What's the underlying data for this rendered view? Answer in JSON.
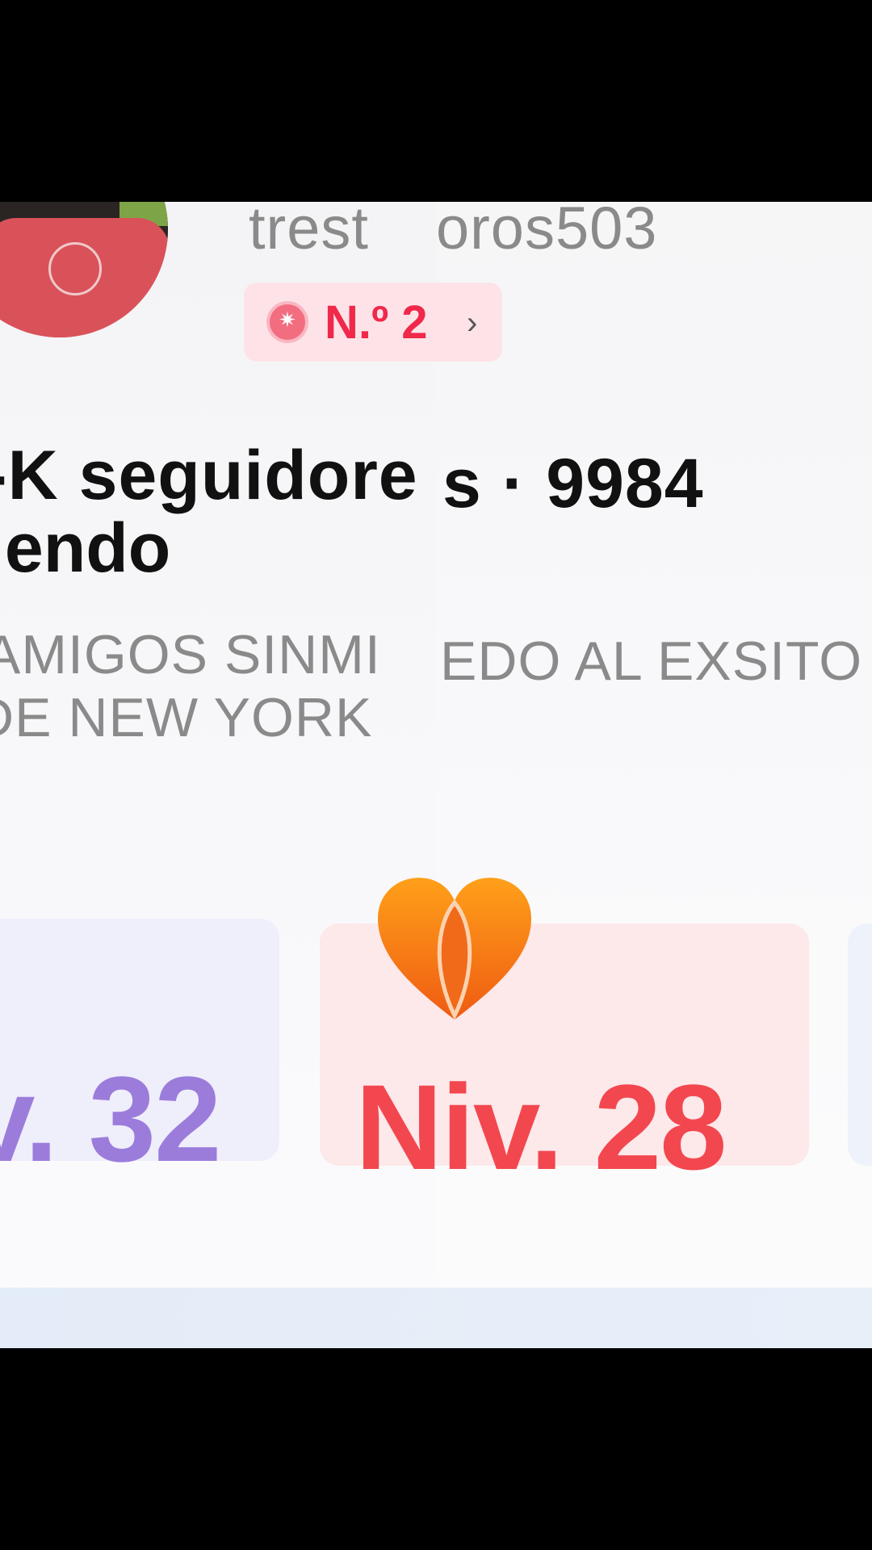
{
  "profile": {
    "username_left": "trest",
    "username_right": "oros503",
    "rank_badge": "N.º 2",
    "rank_chevron": "›",
    "stats_line1_left": "-K seguidore",
    "stats_line1_right": "s · 9984",
    "stats_line2": "iendo",
    "bio_line1_left": "AMIGOS SINMI",
    "bio_line1_right": "EDO AL EXSITO",
    "bio_line2": "DE NEW YORK"
  },
  "levels": [
    {
      "label": "v. 32",
      "color": "#9b7cdb"
    },
    {
      "label": "Niv. 28",
      "color": "#f2474f"
    }
  ],
  "icons": {
    "badge_icon": "medal-icon",
    "level_icon": "flame-heart-icon"
  }
}
